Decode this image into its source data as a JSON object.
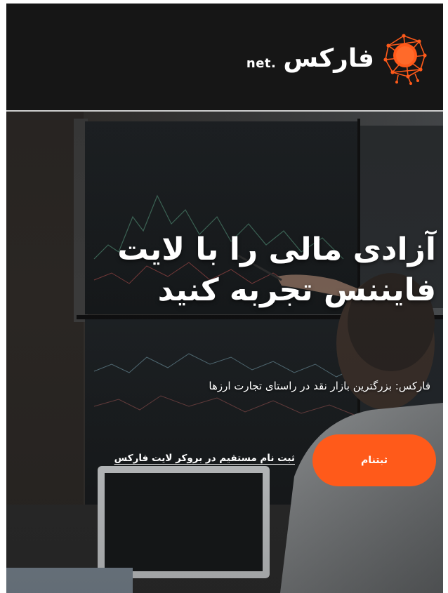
{
  "header": {
    "logo_word": "فارکس",
    "logo_suffix": "net.",
    "brand_color": "#ff5a1a",
    "logo_icon": "orange-network-sphere-icon"
  },
  "hero": {
    "background": "trader-at-monitors-photo",
    "title": "آزادی مالی را با لایت فایننس تجربه کنید",
    "subtitle": "فارکس: بزرگترین بازار نقد در راستای تجارت ارزها",
    "signup_button": "ثبتنام",
    "direct_link": "ثبت نام مستقیم در بروکر لایت فارکس"
  }
}
